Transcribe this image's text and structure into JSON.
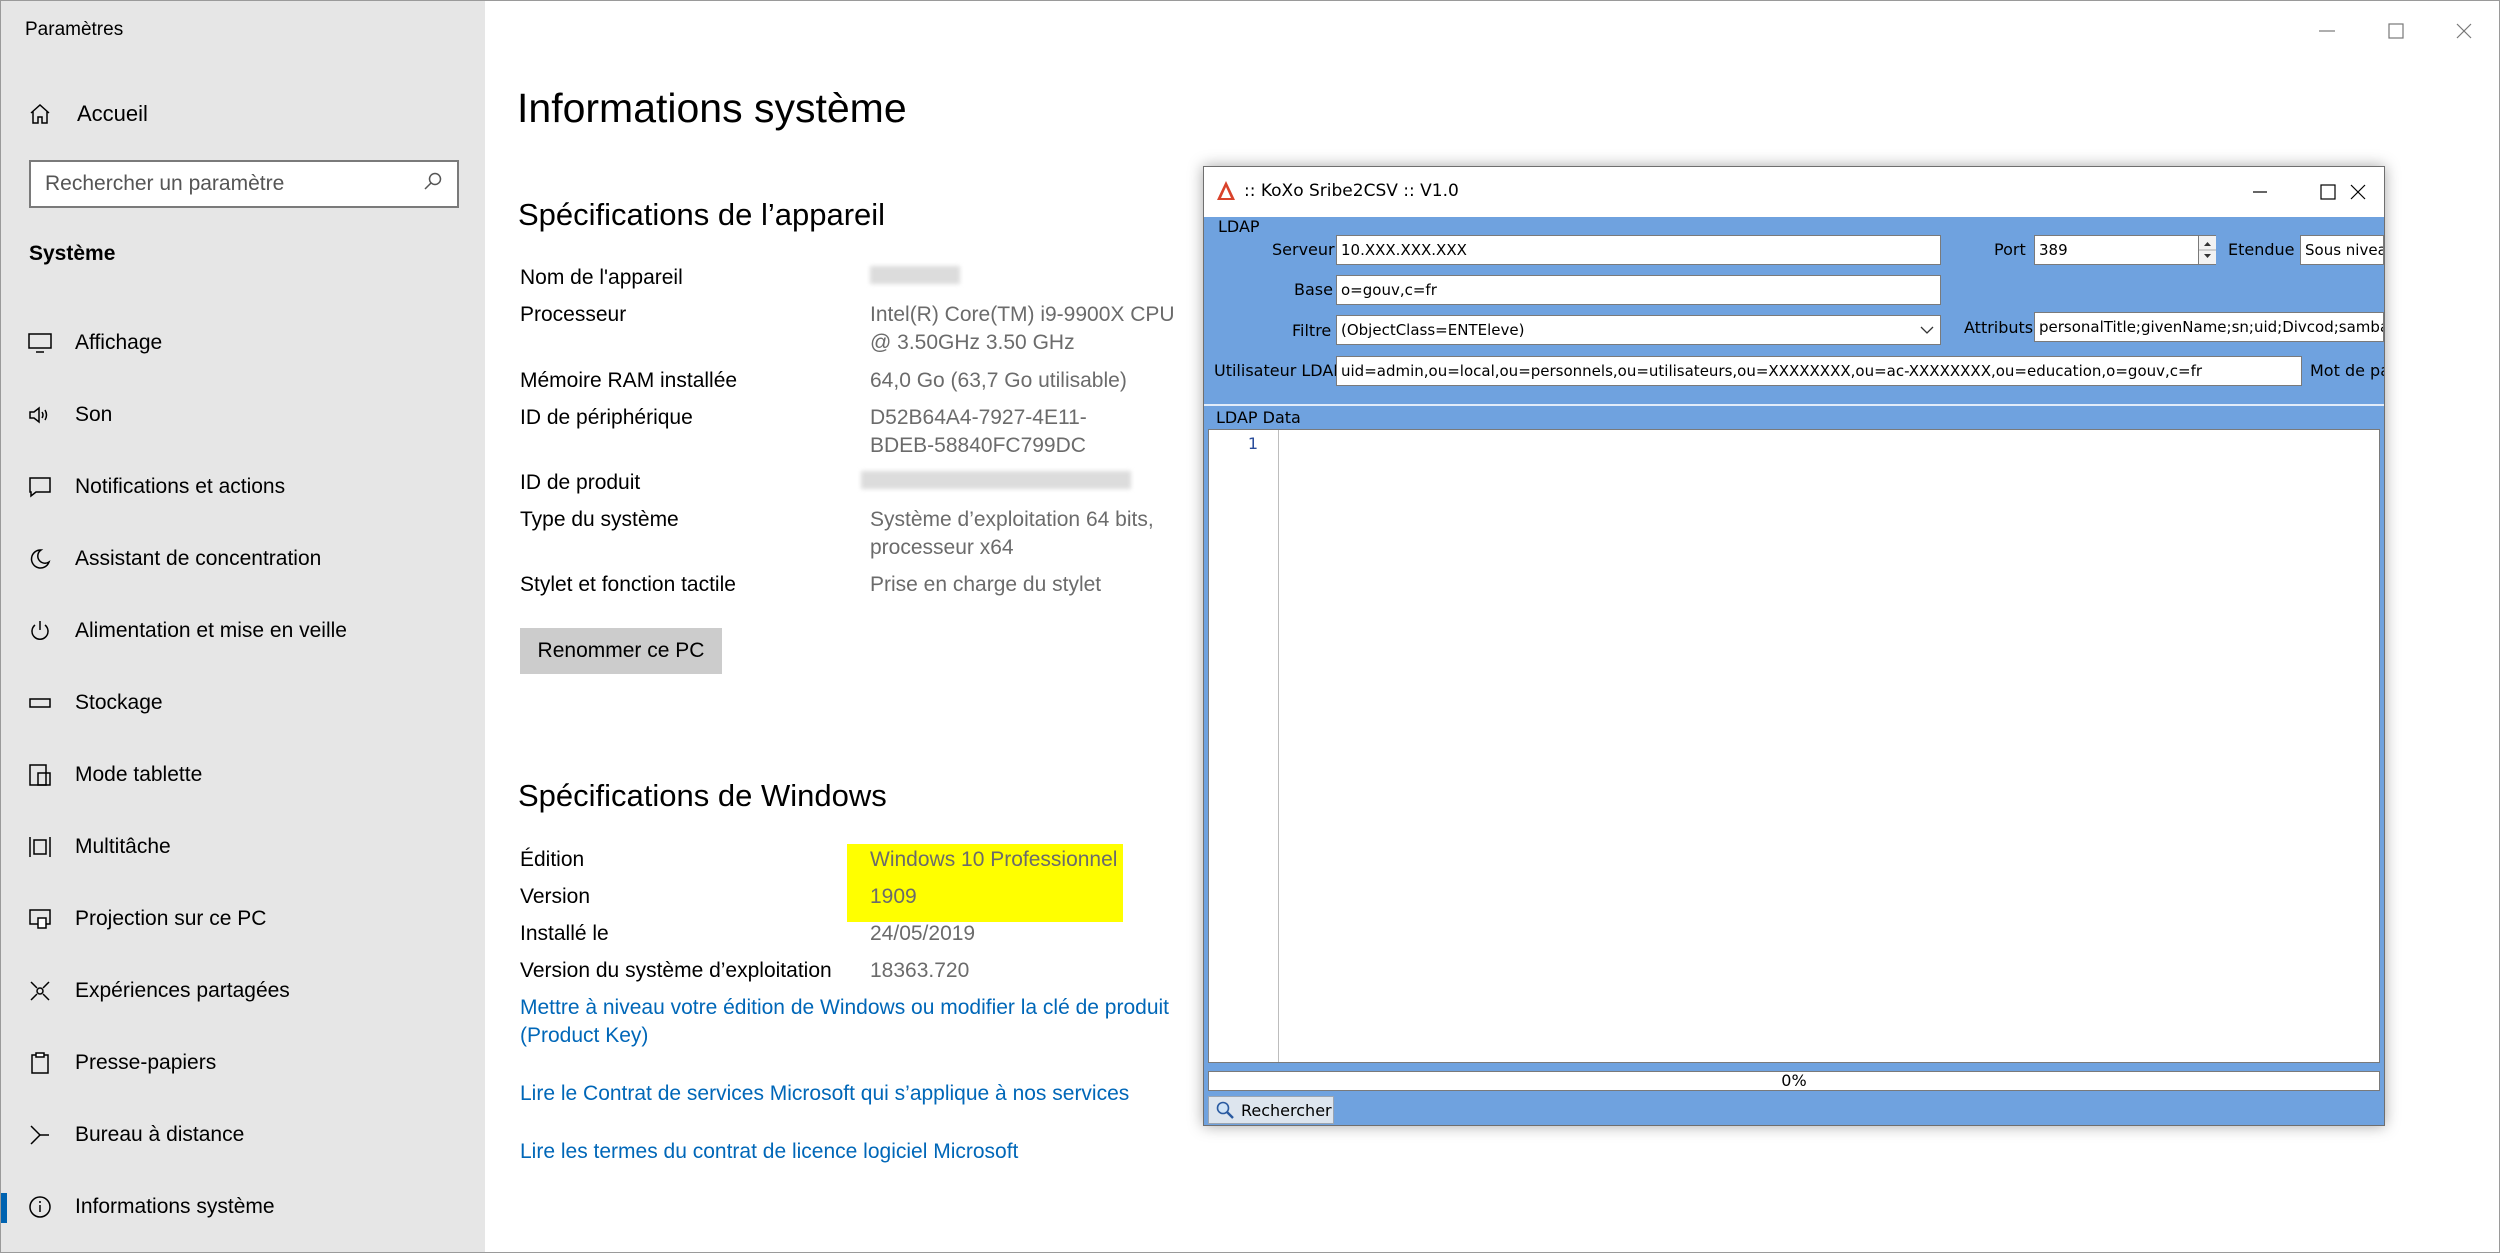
{
  "settings": {
    "window_title": "Paramètres",
    "home_label": "Accueil",
    "search_placeholder": "Rechercher un paramètre",
    "section_label": "Système",
    "nav_items": [
      {
        "label": "Affichage",
        "icon": "display-icon"
      },
      {
        "label": "Son",
        "icon": "speaker-icon"
      },
      {
        "label": "Notifications et actions",
        "icon": "notification-icon"
      },
      {
        "label": "Assistant de concentration",
        "icon": "moon-icon"
      },
      {
        "label": "Alimentation et mise en veille",
        "icon": "power-icon"
      },
      {
        "label": "Stockage",
        "icon": "storage-icon"
      },
      {
        "label": "Mode tablette",
        "icon": "tablet-icon"
      },
      {
        "label": "Multitâche",
        "icon": "multitask-icon"
      },
      {
        "label": "Projection sur ce PC",
        "icon": "projection-icon"
      },
      {
        "label": "Expériences partagées",
        "icon": "shared-icon"
      },
      {
        "label": "Presse-papiers",
        "icon": "clipboard-icon"
      },
      {
        "label": "Bureau à distance",
        "icon": "remote-desktop-icon"
      },
      {
        "label": "Informations système",
        "icon": "info-icon",
        "active": true
      }
    ],
    "page_title": "Informations système",
    "device_specs": {
      "heading": "Spécifications de l’appareil",
      "rows": [
        {
          "label": "Nom de l'appareil",
          "value": ""
        },
        {
          "label": "Processeur",
          "value": "Intel(R) Core(TM) i9-9900X CPU @ 3.50GHz   3.50 GHz"
        },
        {
          "label": "Mémoire RAM installée",
          "value": "64,0 Go (63,7 Go utilisable)"
        },
        {
          "label": "ID de périphérique",
          "value": "D52B64A4-7927-4E11-BDEB-58840FC799DC"
        },
        {
          "label": "ID de produit",
          "value": ""
        },
        {
          "label": "Type du système",
          "value": "Système d’exploitation 64 bits, processeur x64"
        },
        {
          "label": "Stylet et fonction tactile",
          "value": "Prise en charge du stylet"
        }
      ],
      "rename_button": "Renommer ce PC"
    },
    "windows_specs": {
      "heading": "Spécifications de Windows",
      "rows": [
        {
          "label": "Édition",
          "value": "Windows 10 Professionnel"
        },
        {
          "label": "Version",
          "value": "1909"
        },
        {
          "label": "Installé le",
          "value": "24/05/2019"
        },
        {
          "label": "Version du système d’exploitation",
          "value": "18363.720"
        }
      ],
      "highlight_color": "#ffff00"
    },
    "links": [
      "Mettre à niveau votre édition de Windows ou modifier la clé de produit (Product Key)",
      "Lire le Contrat de services Microsoft qui s’applique à nos services",
      "Lire les termes du contrat de licence logiciel Microsoft"
    ],
    "colors": {
      "sidebar_bg": "#e6e6e6",
      "link": "#0067b8",
      "accent": "#0063b1"
    }
  },
  "koxo": {
    "title": ":: KoXo Sribe2CSV :: V1.0",
    "ldap_group": "LDAP",
    "serveur_label": "Serveur",
    "serveur_value": "10.XXX.XXX.XXX",
    "port_label": "Port",
    "port_value": "389",
    "etendue_label": "Etendue",
    "etendue_value": "Sous niveau",
    "base_label": "Base",
    "base_value": "o=gouv,c=fr",
    "filtre_label": "Filtre",
    "filtre_value": "(ObjectClass=ENTEleve)",
    "attributs_label": "Attributs",
    "attributs_value": "personalTitle;givenName;sn;uid;Divcod;sambaHomePath",
    "user_label": "Utilisateur LDAP",
    "user_value": "uid=admin,ou=local,ou=personnels,ou=utilisateurs,ou=XXXXXXXX,ou=ac-XXXXXXXX,ou=education,o=gouv,c=fr",
    "password_label": "Mot de passe",
    "data_group": "LDAP Data",
    "line_number": "1",
    "progress": "0%",
    "search_button": "Rechercher",
    "colors": {
      "bg": "#6fa2df"
    }
  }
}
